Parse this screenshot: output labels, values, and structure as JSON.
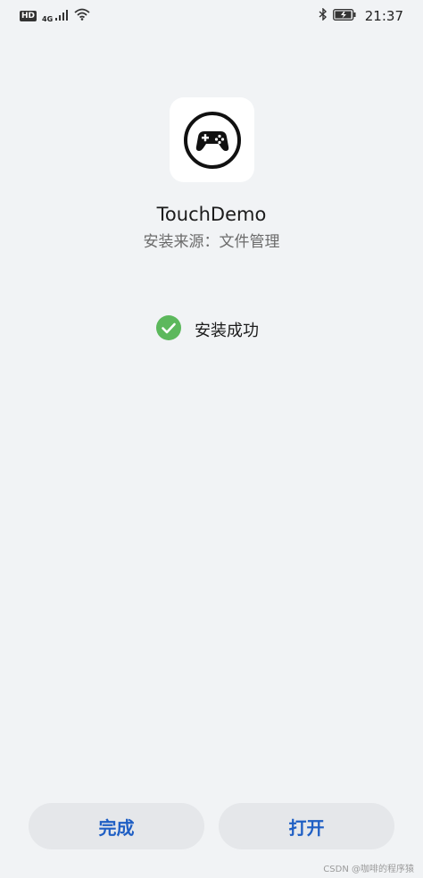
{
  "status_bar": {
    "hd": "HD",
    "network_type": "4G",
    "time": "21:37",
    "icons": [
      "hd-badge",
      "signal-icon",
      "wifi-icon",
      "bluetooth-icon",
      "battery-charging-icon"
    ]
  },
  "app": {
    "icon": "gamepad-icon",
    "name": "TouchDemo",
    "source": "安装来源：文件管理"
  },
  "result": {
    "icon": "check-circle-icon",
    "text": "安装成功",
    "color": "#5cb85c"
  },
  "buttons": {
    "done_label": "完成",
    "open_label": "打开",
    "accent": "#1f5fc4"
  },
  "watermark": "CSDN @咖啡的程序猿"
}
